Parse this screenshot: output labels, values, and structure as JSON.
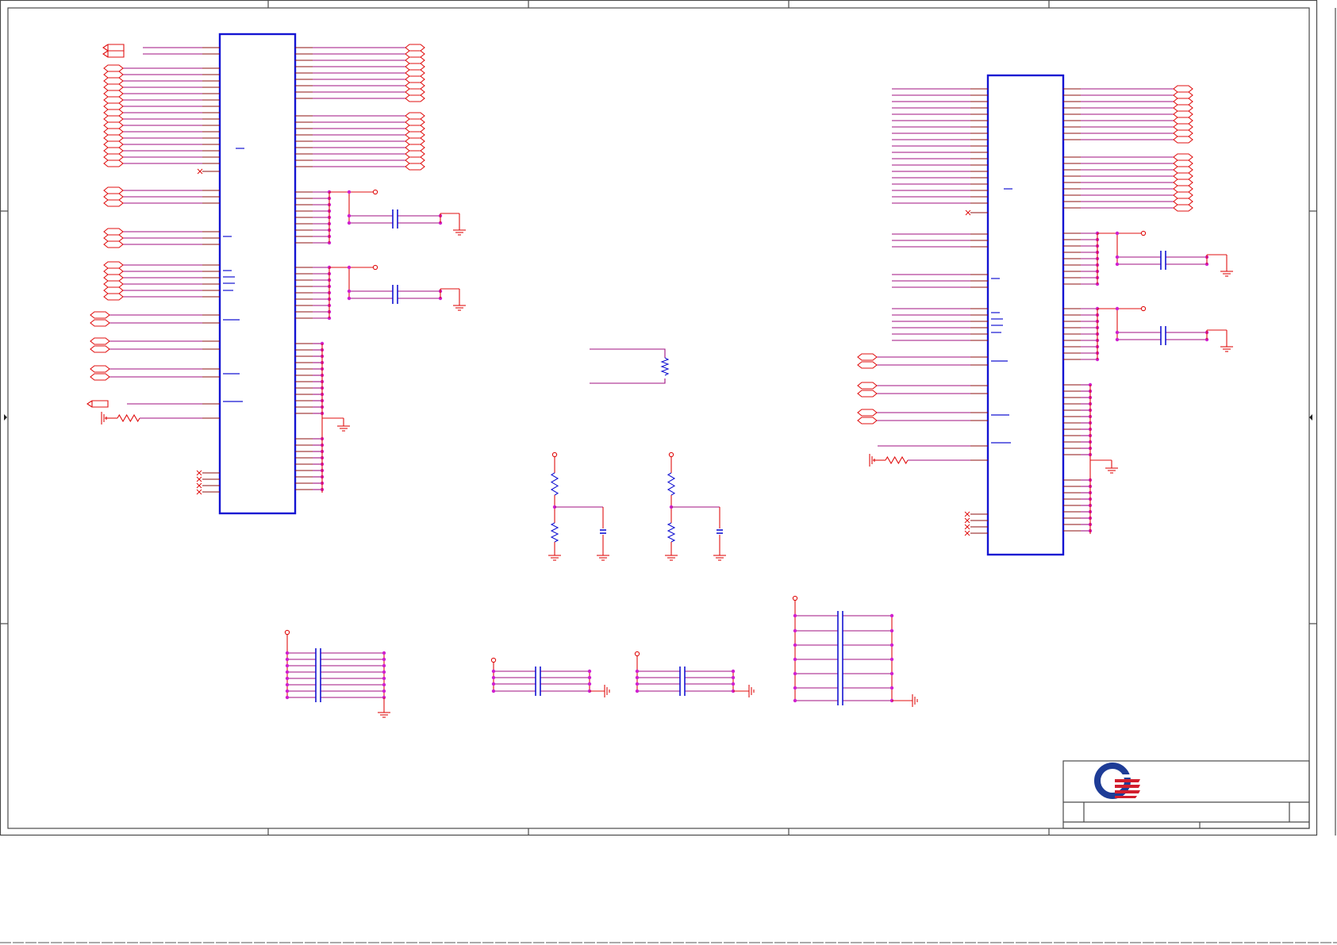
{
  "drawing": {
    "logo": {
      "symbol": "company-logo",
      "colors": {
        "ring": "#1e3c96",
        "bars": "#d21e2d"
      }
    }
  },
  "colors": {
    "frame": "#4a4a4a",
    "component_body": "#1414d2",
    "wire": "#e01010",
    "bus_wire": "#a01080",
    "junction": "#d020d0"
  }
}
